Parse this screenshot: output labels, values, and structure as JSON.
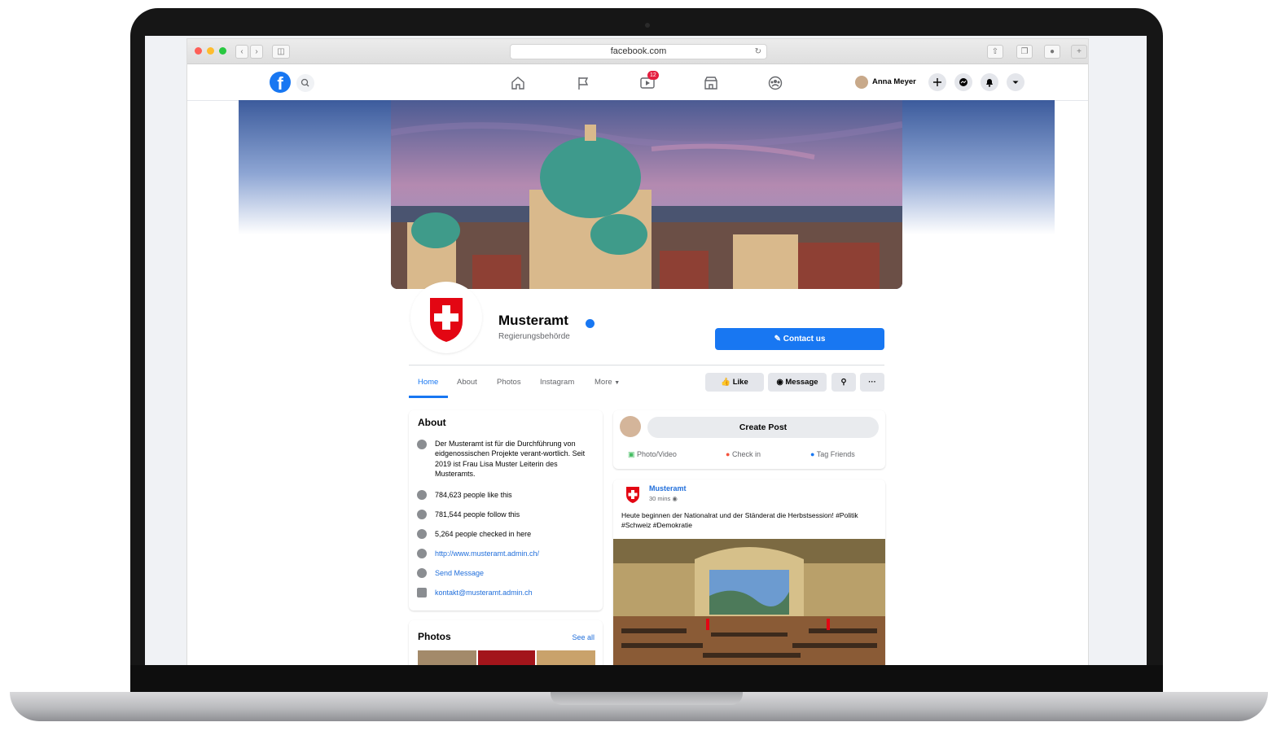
{
  "browser": {
    "url": "facebook.com"
  },
  "nav": {
    "notification_count": "12",
    "user_name": "Anna Meyer"
  },
  "page": {
    "name": "Musteramt",
    "category": "Regierungsbehörde",
    "contact_button": "Contact us",
    "tabs": [
      {
        "label": "Home"
      },
      {
        "label": "About"
      },
      {
        "label": "Photos"
      },
      {
        "label": "Instagram"
      },
      {
        "label": "More"
      }
    ],
    "actions": {
      "like": "Like",
      "message": "Message"
    }
  },
  "about": {
    "title": "About",
    "description": "Der Musteramt ist für die Durchführung von eidgenossischen Projekte verant-wortlich. Seit 2019 ist Frau Lisa Muster Leiterin des Musteramts.",
    "likes": "784,623 people like this",
    "follows": "781,544 people follow this",
    "checkins": "5,264 people checked in here",
    "website": "http://www.musteramt.admin.ch/",
    "send_message": "Send Message",
    "email": "kontakt@musteramt.admin.ch"
  },
  "photos": {
    "title": "Photos",
    "see_all": "See all"
  },
  "composer": {
    "create_post": "Create Post",
    "photo_video": "Photo/Video",
    "check_in": "Check in",
    "tag_friends": "Tag Friends"
  },
  "post": {
    "author": "Musteramt",
    "time": "30 mins",
    "text": "Heute beginnen der Nationalrat und der Ständerat die Herbstsession! #Politik #Schweiz #Demokratie"
  },
  "colors": {
    "brand": "#1877f2",
    "swiss_red": "#e30613"
  }
}
